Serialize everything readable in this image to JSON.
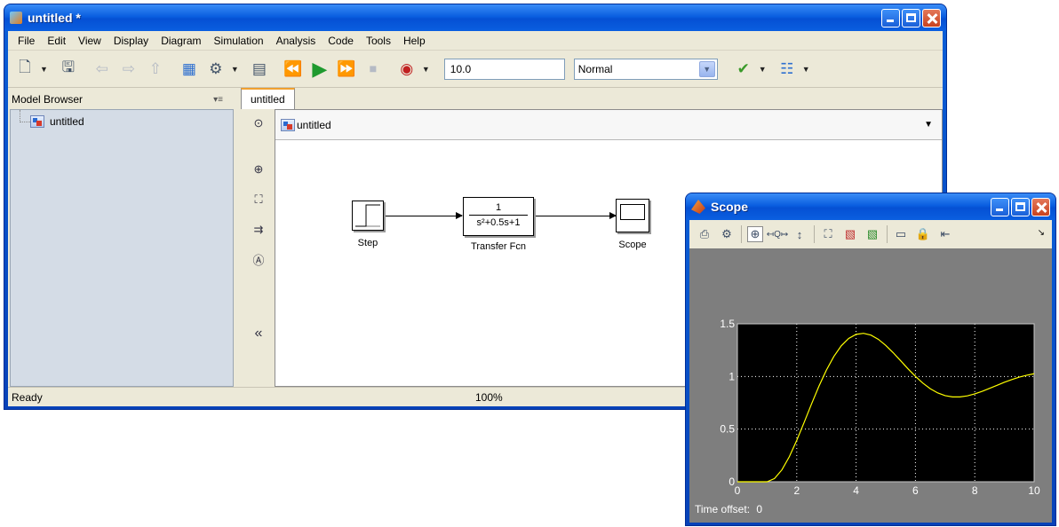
{
  "main_window": {
    "title": "untitled *",
    "menu": [
      "File",
      "Edit",
      "View",
      "Display",
      "Diagram",
      "Simulation",
      "Analysis",
      "Code",
      "Tools",
      "Help"
    ],
    "toolbar": {
      "stop_time": "10.0",
      "sim_mode": "Normal"
    },
    "model_browser": {
      "label": "Model Browser",
      "tree": [
        {
          "label": "untitled"
        }
      ]
    },
    "tab": "untitled",
    "address": "untitled",
    "blocks": {
      "step": "Step",
      "tf_numerator": "1",
      "tf_denominator": "s²+0.5s+1",
      "tf_label": "Transfer Fcn",
      "scope": "Scope"
    },
    "status": {
      "left": "Ready",
      "zoom": "100%"
    }
  },
  "scope_window": {
    "title": "Scope",
    "time_offset_label": "Time offset:",
    "time_offset_value": "0",
    "colors": {
      "background": "#7e7e7e",
      "axes": "#000000",
      "trace": "#ffff00",
      "grid": "#ffffff"
    }
  },
  "chart_data": {
    "type": "line",
    "title": "",
    "xlabel": "",
    "ylabel": "",
    "xlim": [
      0,
      10
    ],
    "ylim": [
      0,
      1.5
    ],
    "xticks": [
      0,
      2,
      4,
      6,
      8,
      10
    ],
    "yticks": [
      0,
      0.5,
      1,
      1.5
    ],
    "grid": true,
    "series": [
      {
        "x": [
          0,
          1,
          1.25,
          1.5,
          1.75,
          2,
          2.25,
          2.5,
          2.75,
          3,
          3.25,
          3.5,
          3.75,
          4,
          4.25,
          4.5,
          4.75,
          5,
          5.25,
          5.5,
          5.75,
          6,
          6.25,
          6.5,
          6.75,
          7,
          7.25,
          7.5,
          7.75,
          8,
          8.25,
          8.5,
          8.75,
          9,
          9.25,
          9.5,
          9.75,
          10
        ],
        "y": [
          0,
          0,
          0.03,
          0.113,
          0.238,
          0.393,
          0.564,
          0.74,
          0.909,
          1.061,
          1.19,
          1.291,
          1.361,
          1.4,
          1.41,
          1.393,
          1.353,
          1.295,
          1.226,
          1.15,
          1.073,
          1.001,
          0.937,
          0.884,
          0.844,
          0.818,
          0.806,
          0.806,
          0.816,
          0.835,
          0.859,
          0.887,
          0.916,
          0.945,
          0.971,
          0.994,
          1.012,
          1.026
        ]
      }
    ]
  }
}
